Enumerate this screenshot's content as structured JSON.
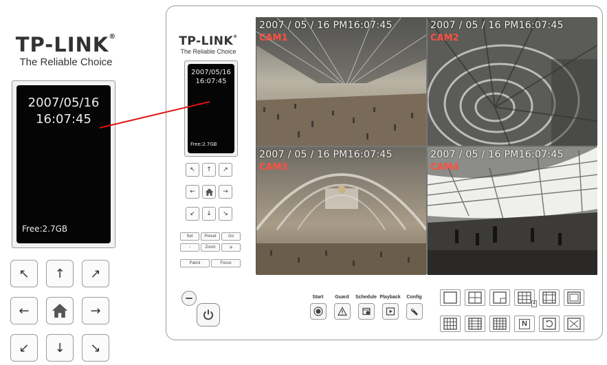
{
  "brand": {
    "logo": "TP-LINK",
    "tagline": "The Reliable Choice"
  },
  "lcd": {
    "date": "2007/05/16",
    "time": "16:07:45",
    "free": "Free:2.7GB"
  },
  "dpad": [
    {
      "name": "up-left",
      "glyph": "↖"
    },
    {
      "name": "up",
      "glyph": "↑"
    },
    {
      "name": "up-right",
      "glyph": "↗"
    },
    {
      "name": "left",
      "glyph": "←"
    },
    {
      "name": "home",
      "glyph": "home"
    },
    {
      "name": "right",
      "glyph": "→"
    },
    {
      "name": "down-left",
      "glyph": "↙"
    },
    {
      "name": "down",
      "glyph": "↓"
    },
    {
      "name": "down-right",
      "glyph": "↘"
    }
  ],
  "ptz": {
    "set": "Set",
    "preset": "Preset",
    "go": "Go",
    "zoom_out": "-",
    "zoom": "Zoom",
    "zoom_in": "+",
    "patrol": "Patrol",
    "focus": "Focus"
  },
  "cameras": [
    {
      "stamp": "2007 / 05 / 16   PM16:07:45",
      "name": "CAM1"
    },
    {
      "stamp": "2007 / 05 / 16   PM16:07:45",
      "name": "CAM2"
    },
    {
      "stamp": "2007 / 05 / 16   PM16:07:45",
      "name": "CAM3"
    },
    {
      "stamp": "2007 / 05 / 16   PM16:07:45",
      "name": "CAM4"
    }
  ],
  "functions": [
    {
      "label": "Start",
      "icon": "record-icon"
    },
    {
      "label": "Guard",
      "icon": "warning-icon"
    },
    {
      "label": "Schedule",
      "icon": "schedule-icon"
    },
    {
      "label": "Playback",
      "icon": "play-icon"
    },
    {
      "label": "Config",
      "icon": "wrench-icon"
    }
  ],
  "layouts": [
    {
      "name": "1-view",
      "badge": ""
    },
    {
      "name": "4-view",
      "badge": ""
    },
    {
      "name": "pip-view",
      "badge": ""
    },
    {
      "name": "9-view",
      "badge": "4"
    },
    {
      "name": "10-view",
      "badge": ""
    },
    {
      "name": "border-view",
      "badge": ""
    },
    {
      "name": "12-view",
      "badge": ""
    },
    {
      "name": "13-view",
      "badge": ""
    },
    {
      "name": "16-view",
      "badge": ""
    },
    {
      "name": "n-view",
      "badge": "N"
    },
    {
      "name": "rotate-view",
      "badge": ""
    },
    {
      "name": "fullscreen-view",
      "badge": ""
    }
  ],
  "colors": {
    "camname": "#ff5040",
    "pointer": "#e01010",
    "lcd_bg": "#050505"
  }
}
